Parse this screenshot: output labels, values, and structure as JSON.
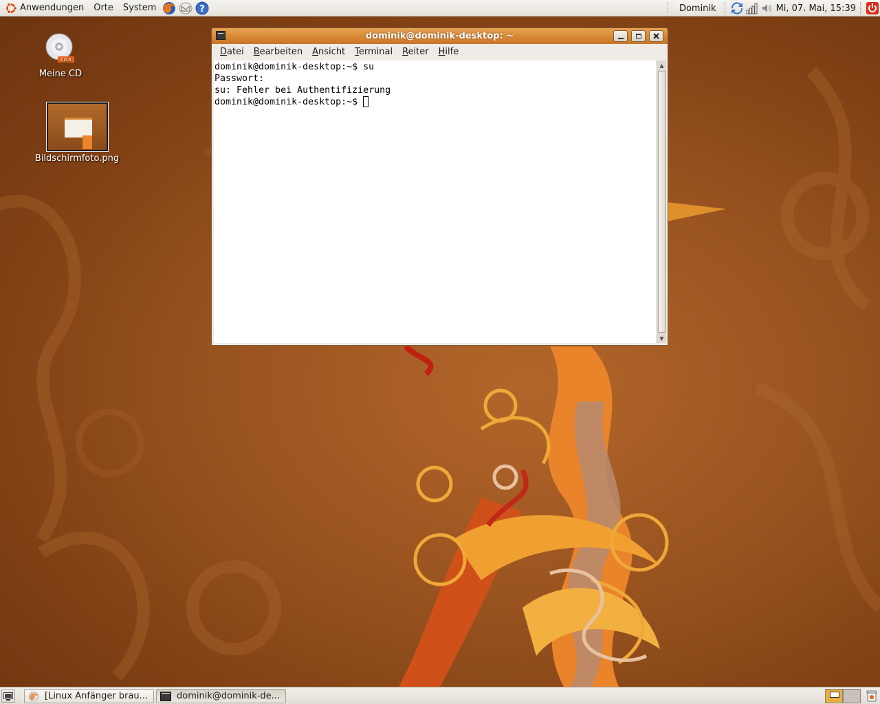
{
  "top_panel": {
    "menus": [
      "Anwendungen",
      "Orte",
      "System"
    ],
    "user": "Dominik",
    "clock": "Mi, 07. Mai, 15:39"
  },
  "desktop": {
    "icons": [
      {
        "label": "Meine CD",
        "badge": "CD-R",
        "icon": "cd-icon"
      },
      {
        "label": "Bildschirmfoto.png",
        "icon": "image-thumbnail"
      }
    ]
  },
  "terminal": {
    "title": "dominik@dominik-desktop: ~",
    "menu": [
      {
        "first": "D",
        "rest": "atei"
      },
      {
        "first": "B",
        "rest": "earbeiten"
      },
      {
        "first": "A",
        "rest": "nsicht"
      },
      {
        "first": "T",
        "rest": "erminal"
      },
      {
        "first": "R",
        "rest": "eiter"
      },
      {
        "first": "H",
        "rest": "ilfe"
      }
    ],
    "lines": [
      "dominik@dominik-desktop:~$ su",
      "Passwort:",
      "su: Fehler bei Authentifizierung",
      "dominik@dominik-desktop:~$ "
    ]
  },
  "taskbar": {
    "tasks": [
      {
        "label": "[Linux Anfänger brau...",
        "icon": "firefox-icon"
      },
      {
        "label": "dominik@dominik-de...",
        "icon": "terminal-icon"
      }
    ]
  },
  "colors": {
    "titlebar": "#d88a35",
    "desktop": "#9a5420",
    "panel": "#ece9e3"
  }
}
